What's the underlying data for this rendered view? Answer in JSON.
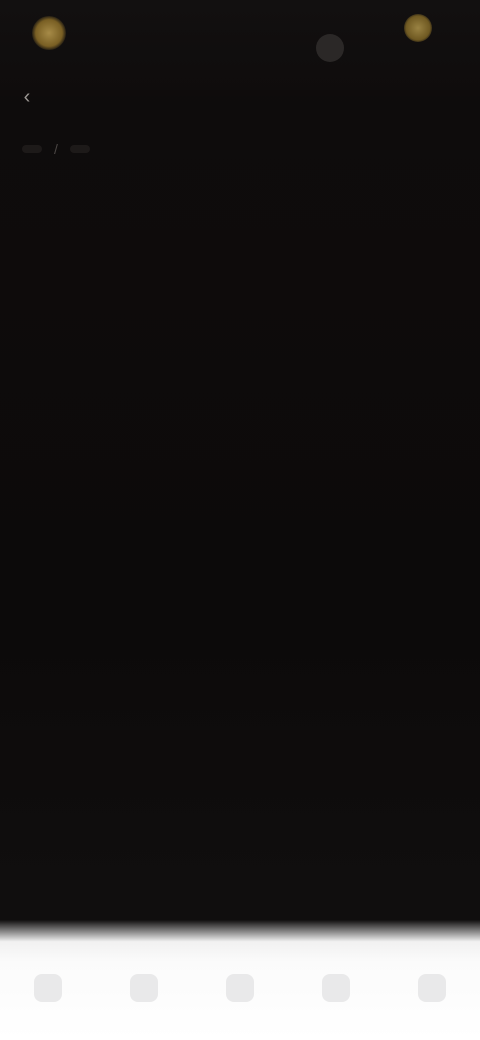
{
  "header": {
    "brand_name": "",
    "account_label": "",
    "ticker_text": ""
  },
  "breadcrumb": {
    "items": [
      "",
      ""
    ]
  },
  "sections": [
    {
      "title": "",
      "paragraph": ""
    },
    {
      "title": "",
      "paragraph": ""
    }
  ],
  "bottom_nav": {
    "items": [
      {
        "label": ""
      },
      {
        "label": ""
      },
      {
        "label": ""
      },
      {
        "label": ""
      },
      {
        "label": ""
      }
    ]
  },
  "colors": {
    "background": "#0c0a0a",
    "accent_gold": "#d8b45a",
    "bottom_nav": "#ffffff"
  },
  "icons": [
    "logo-icon",
    "coin-icon",
    "back-icon"
  ]
}
